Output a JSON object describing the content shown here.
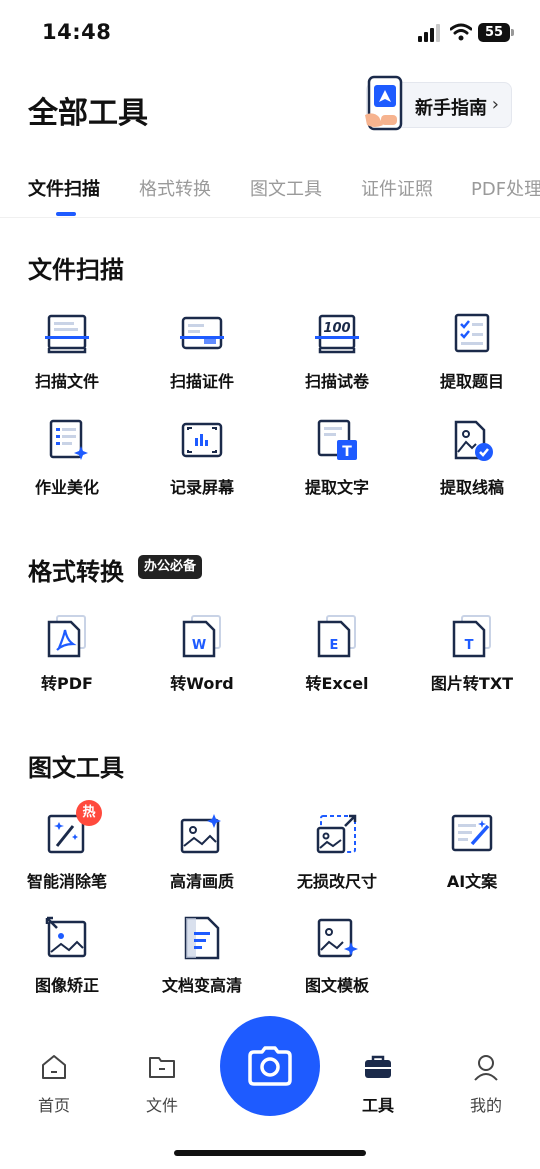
{
  "status_bar": {
    "time": "14:48",
    "battery": "55"
  },
  "header": {
    "title": "全部工具",
    "guide_label": "新手指南",
    "guide_chevron": "›"
  },
  "tabs": [
    {
      "label": "文件扫描",
      "active": true
    },
    {
      "label": "格式转换",
      "active": false
    },
    {
      "label": "图文工具",
      "active": false
    },
    {
      "label": "证件证照",
      "active": false
    },
    {
      "label": "PDF处理",
      "active": false
    }
  ],
  "sections": {
    "scan": {
      "title": "文件扫描",
      "tools": [
        {
          "label": "扫描文件",
          "icon": "scan-document-icon"
        },
        {
          "label": "扫描证件",
          "icon": "scan-id-card-icon"
        },
        {
          "label": "扫描试卷",
          "icon": "scan-exam-icon"
        },
        {
          "label": "提取题目",
          "icon": "extract-questions-icon"
        },
        {
          "label": "作业美化",
          "icon": "homework-beautify-icon"
        },
        {
          "label": "记录屏幕",
          "icon": "record-screen-icon"
        },
        {
          "label": "提取文字",
          "icon": "extract-text-icon"
        },
        {
          "label": "提取线稿",
          "icon": "extract-lineart-icon"
        }
      ]
    },
    "convert": {
      "title": "格式转换",
      "badge": "办公必备",
      "tools": [
        {
          "label": "转PDF",
          "icon": "pdf-file-icon"
        },
        {
          "label": "转Word",
          "icon": "word-file-icon"
        },
        {
          "label": "转Excel",
          "icon": "excel-file-icon"
        },
        {
          "label": "图片转TXT",
          "icon": "txt-file-icon"
        }
      ]
    },
    "image_tools": {
      "title": "图文工具",
      "hot_badge": "热",
      "tools": [
        {
          "label": "智能消除笔",
          "icon": "magic-eraser-icon"
        },
        {
          "label": "高清画质",
          "icon": "hd-image-icon"
        },
        {
          "label": "无损改尺寸",
          "icon": "resize-image-icon"
        },
        {
          "label": "AI文案",
          "icon": "ai-copywriting-icon"
        },
        {
          "label": "图像矫正",
          "icon": "image-correct-icon"
        },
        {
          "label": "文档变高清",
          "icon": "document-hd-icon"
        },
        {
          "label": "图文模板",
          "icon": "image-template-icon"
        }
      ]
    }
  },
  "bottom_nav": [
    {
      "label": "首页",
      "icon": "home-icon",
      "active": false
    },
    {
      "label": "文件",
      "icon": "folder-icon",
      "active": false
    },
    {
      "label": "工具",
      "icon": "toolbox-icon",
      "active": true
    },
    {
      "label": "我的",
      "icon": "profile-icon",
      "active": false
    }
  ],
  "colors": {
    "accent": "#1e5bff",
    "hot": "#ff4a3d",
    "badge": "#222222"
  }
}
